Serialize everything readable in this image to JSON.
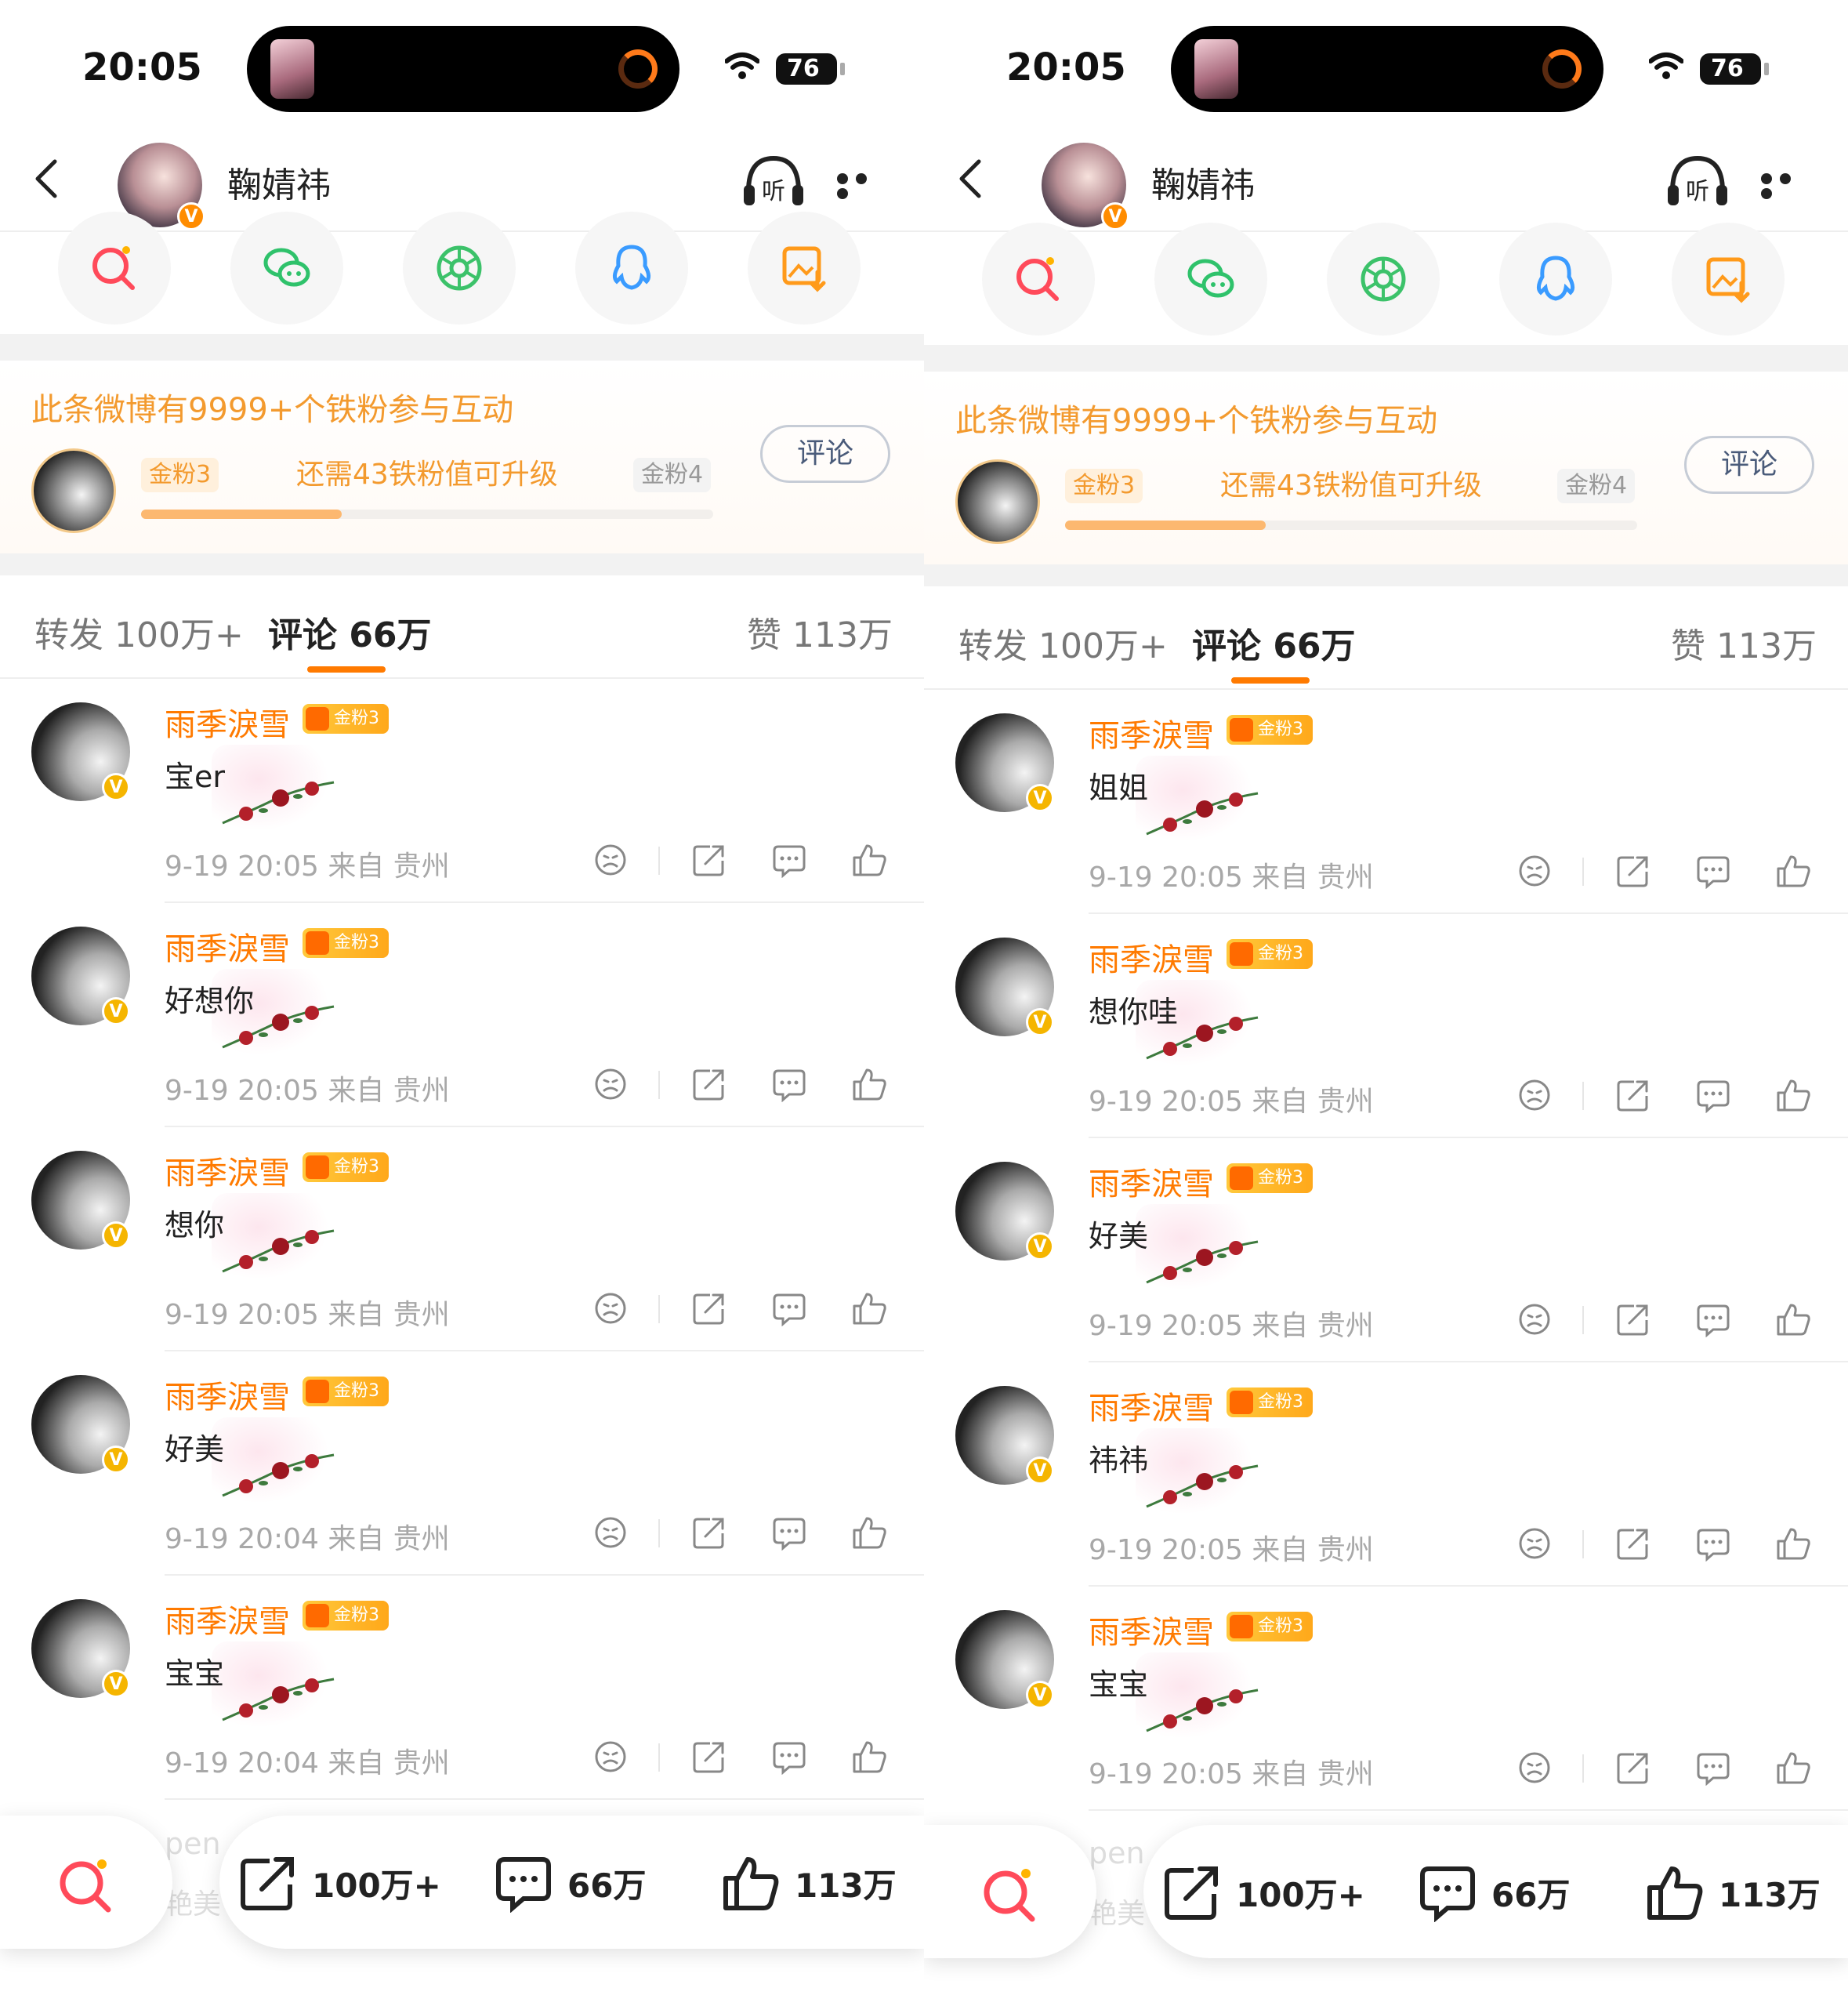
{
  "status": {
    "time": "20:05",
    "battery": "76"
  },
  "nav": {
    "name": "鞠婧祎",
    "listen_label": "听"
  },
  "fan": {
    "title": "此条微博有9999+个铁粉参与互动",
    "current_level": "金粉3",
    "next_level": "金粉4",
    "need": "还需43铁粉值可升级",
    "progress_fraction": 0.35,
    "comment_button": "评论"
  },
  "tabs": {
    "repost": "转发 100万+",
    "comment": "评论 66万",
    "like": "赞 113万"
  },
  "screens": [
    {
      "comments": [
        {
          "name": "雨季淚雪",
          "badge": "金粉3",
          "text": "宝er",
          "meta": "9-19 20:05 来自 贵州"
        },
        {
          "name": "雨季淚雪",
          "badge": "金粉3",
          "text": "好想你",
          "meta": "9-19 20:05 来自 贵州"
        },
        {
          "name": "雨季淚雪",
          "badge": "金粉3",
          "text": "想你",
          "meta": "9-19 20:05 来自 贵州"
        },
        {
          "name": "雨季淚雪",
          "badge": "金粉3",
          "text": "好美",
          "meta": "9-19 20:04 来自 贵州"
        },
        {
          "name": "雨季淚雪",
          "badge": "金粉3",
          "text": "宝宝",
          "meta": "9-19 20:04 来自 贵州"
        }
      ]
    },
    {
      "comments": [
        {
          "name": "雨季淚雪",
          "badge": "金粉3",
          "text": "姐姐",
          "meta": "9-19 20:05 来自 贵州"
        },
        {
          "name": "雨季淚雪",
          "badge": "金粉3",
          "text": "想你哇",
          "meta": "9-19 20:05 来自 贵州"
        },
        {
          "name": "雨季淚雪",
          "badge": "金粉3",
          "text": "好美",
          "meta": "9-19 20:05 来自 贵州"
        },
        {
          "name": "雨季淚雪",
          "badge": "金粉3",
          "text": "祎祎",
          "meta": "9-19 20:05 来自 贵州"
        },
        {
          "name": "雨季淚雪",
          "badge": "金粉3",
          "text": "宝宝",
          "meta": "9-19 20:05 来自 贵州"
        }
      ]
    }
  ],
  "bottom": {
    "repost": "100万+",
    "comment": "66万",
    "like": "113万",
    "peek_text": "pen",
    "peek_text2": "艳美"
  },
  "colors": {
    "accent": "#ff7a00",
    "fan_orange": "#f39a2e",
    "muted": "#a8a8a8"
  }
}
